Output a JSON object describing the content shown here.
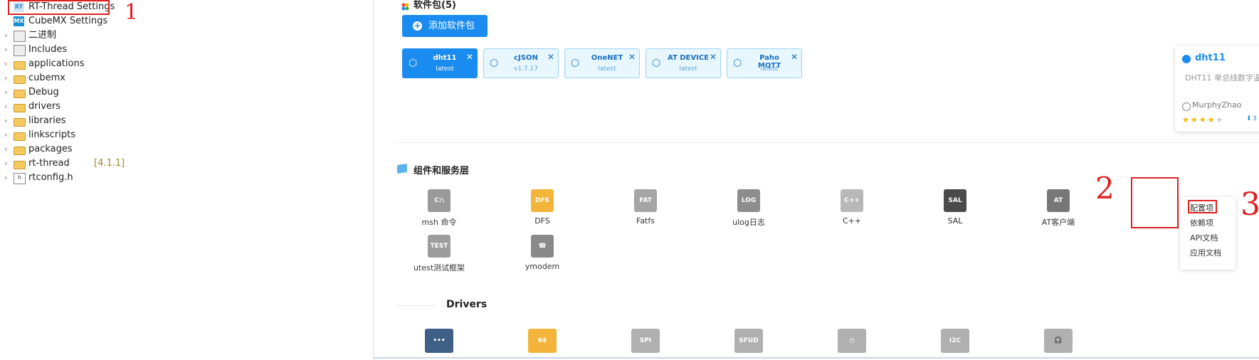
{
  "tree": {
    "items": [
      {
        "label": "RT-Thread Settings",
        "icon": "rt-thread-settings-icon",
        "badge": "RT",
        "expandable": false
      },
      {
        "label": "CubeMX Settings",
        "icon": "cubemx-settings-icon",
        "badge": "MX",
        "expandable": false
      },
      {
        "label": "二进制",
        "icon": "binaries-icon",
        "expandable": true
      },
      {
        "label": "Includes",
        "icon": "includes-icon",
        "expandable": true
      },
      {
        "label": "applications",
        "icon": "folder-icon",
        "expandable": true
      },
      {
        "label": "cubemx",
        "icon": "folder-icon",
        "expandable": true
      },
      {
        "label": "Debug",
        "icon": "folder-icon",
        "expandable": true
      },
      {
        "label": "drivers",
        "icon": "folder-icon",
        "expandable": true
      },
      {
        "label": "libraries",
        "icon": "folder-icon",
        "expandable": true
      },
      {
        "label": "linkscripts",
        "icon": "folder-icon",
        "expandable": true
      },
      {
        "label": "packages",
        "icon": "folder-icon",
        "expandable": true
      },
      {
        "label": "rt-thread",
        "version": "[4.1.1]",
        "icon": "folder-icon",
        "expandable": true
      },
      {
        "label": "rtconfig.h",
        "icon": "header-file-icon",
        "badge": "h",
        "expandable": true
      }
    ],
    "arrow_glyph": "›"
  },
  "annotations": {
    "one": "1",
    "two": "2",
    "three": "3"
  },
  "packages_section": {
    "title": "软件包(5)",
    "add_button_label": "添加软件包",
    "add_icon_glyph": "+",
    "close_glyph": "✕",
    "package_icon_glyph": "⬡",
    "items": [
      {
        "name": "dht11",
        "version": "latest",
        "active": true
      },
      {
        "name": "cJSON",
        "version": "v1.7.17",
        "active": false
      },
      {
        "name": "OneNET",
        "version": "latest",
        "active": false
      },
      {
        "name": "AT DEVICE",
        "version": "latest",
        "active": false
      },
      {
        "name": "Paho MQTT",
        "version": "latest",
        "active": false
      }
    ]
  },
  "detail_card": {
    "name": "dht11",
    "description": "DHT11 单总线数字温",
    "author": "MurphyZhao",
    "rating": 4,
    "stars_glyph": "★",
    "downloads": "3"
  },
  "components_section": {
    "title": "组件和服务层",
    "items": [
      {
        "label": "msh 命令",
        "icon": "msh-command-icon",
        "glyph": "C:\\"
      },
      {
        "label": "DFS",
        "icon": "dfs-folder-icon",
        "glyph": "DFS"
      },
      {
        "label": "Fatfs",
        "icon": "fatfs-icon",
        "glyph": "FAT"
      },
      {
        "label": "ulog日志",
        "icon": "ulog-icon",
        "glyph": "LOG"
      },
      {
        "label": "C++",
        "icon": "cpp-file-icon",
        "glyph": "C++"
      },
      {
        "label": "SAL",
        "icon": "sal-router-icon",
        "glyph": "SAL"
      },
      {
        "label": "AT客户端",
        "icon": "at-client-icon",
        "glyph": "AT"
      },
      {
        "label": "utest测试框架",
        "icon": "utest-flask-icon",
        "glyph": "TEST"
      },
      {
        "label": "ymodem",
        "icon": "ymodem-phone-icon",
        "glyph": "☎"
      }
    ]
  },
  "context_menu": {
    "items": [
      "配置项",
      "依赖项",
      "API文档",
      "应用文档"
    ]
  },
  "drivers_section": {
    "title": "Drivers",
    "icons": [
      {
        "icon": "serial-port-icon",
        "glyph": "•••"
      },
      {
        "icon": "chip-64-icon",
        "glyph": "64"
      },
      {
        "icon": "spi-icon",
        "glyph": "SPI"
      },
      {
        "icon": "sfud-icon",
        "glyph": "SFUD"
      },
      {
        "icon": "alarm-clock-icon",
        "glyph": "◷"
      },
      {
        "icon": "i2c-icon",
        "glyph": "I2C"
      },
      {
        "icon": "headphones-icon",
        "glyph": "🎧"
      }
    ]
  },
  "colors": {
    "accent": "#1a8cf0",
    "highlight": "#e02020",
    "folder": "#f4c95d"
  }
}
